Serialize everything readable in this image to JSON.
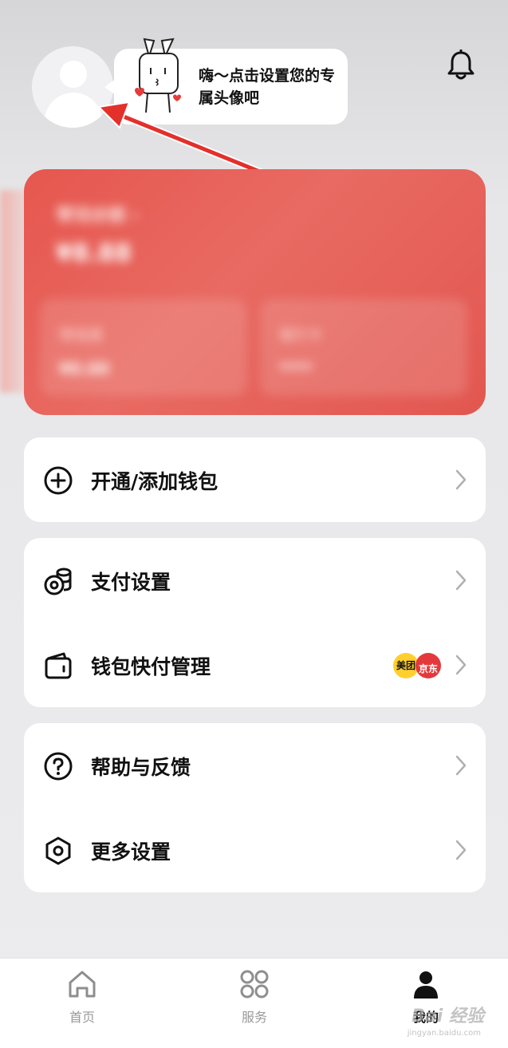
{
  "header": {
    "bubble_text": "嗨～点击设置您的专属头像吧",
    "bell_icon": "bell-icon"
  },
  "balance_card": {
    "label": "零钱余额 ›",
    "value": "¥8.88",
    "sub_left": {
      "title": "零钱通",
      "value": "¥0.00"
    },
    "sub_right": {
      "title": "银行卡",
      "value": "****"
    },
    "colors": {
      "primary": "#e6574f",
      "secondary": "#e86a62"
    }
  },
  "menu": {
    "group1": [
      {
        "label": "开通/添加钱包",
        "icon": "plus-circle-icon"
      }
    ],
    "group2": [
      {
        "label": "支付设置",
        "icon": "coins-icon"
      },
      {
        "label": "钱包快付管理",
        "icon": "wallet-icon",
        "badges": [
          "美团",
          "京东"
        ]
      }
    ],
    "group3": [
      {
        "label": "帮助与反馈",
        "icon": "question-circle-icon"
      },
      {
        "label": "更多设置",
        "icon": "hexagon-settings-icon"
      }
    ]
  },
  "tabbar": {
    "tabs": [
      {
        "label": "首页",
        "icon": "home-icon"
      },
      {
        "label": "服务",
        "icon": "grid-icon"
      },
      {
        "label": "我的",
        "icon": "person-icon",
        "active": true
      }
    ],
    "watermark": "Bai 经验",
    "watermark_sub": "jingyan.baidu.com"
  }
}
